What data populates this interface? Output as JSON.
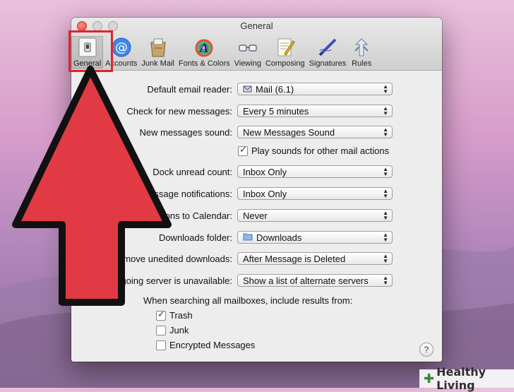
{
  "window": {
    "title": "General"
  },
  "toolbar": {
    "items": [
      {
        "label": "General",
        "icon": "light-switch-icon",
        "selected": true
      },
      {
        "label": "Accounts",
        "icon": "at-sign-icon"
      },
      {
        "label": "Junk Mail",
        "icon": "junk-mail-icon"
      },
      {
        "label": "Fonts & Colors",
        "icon": "fonts-colors-icon"
      },
      {
        "label": "Viewing",
        "icon": "glasses-icon"
      },
      {
        "label": "Composing",
        "icon": "composing-pencil-icon"
      },
      {
        "label": "Signatures",
        "icon": "signature-pen-icon"
      },
      {
        "label": "Rules",
        "icon": "rules-icon"
      }
    ]
  },
  "settings": {
    "default_email_reader": {
      "label": "Default email reader:",
      "value": "Mail (6.1)"
    },
    "check_new_messages": {
      "label": "Check for new messages:",
      "value": "Every 5 minutes"
    },
    "new_messages_sound": {
      "label": "New messages sound:",
      "value": "New Messages Sound"
    },
    "play_sounds": {
      "label": "Play sounds for other mail actions",
      "checked": true
    },
    "dock_unread_count": {
      "label": "Dock unread count:",
      "value": "Inbox Only"
    },
    "new_message_notifications": {
      "label": "New message notifications:",
      "value": "Inbox Only"
    },
    "add_invitations": {
      "label": "Add invitations to Calendar:",
      "value": "Never"
    },
    "downloads_folder": {
      "label": "Downloads folder:",
      "value": "Downloads"
    },
    "remove_unedited": {
      "label": "Remove unedited downloads:",
      "value": "After Message is Deleted"
    },
    "outgoing_unavailable": {
      "label": "If outgoing server is unavailable:",
      "value": "Show a list of alternate servers"
    }
  },
  "search": {
    "heading": "When searching all mailboxes, include results from:",
    "options": [
      {
        "label": "Trash",
        "checked": true
      },
      {
        "label": "Junk",
        "checked": false
      },
      {
        "label": "Encrypted Messages",
        "checked": false
      }
    ]
  },
  "help": {
    "label": "?"
  },
  "watermark": {
    "label": "Healthy Living"
  },
  "colors": {
    "accent_red": "#e0242d",
    "arrow_fill": "#e23a45"
  }
}
